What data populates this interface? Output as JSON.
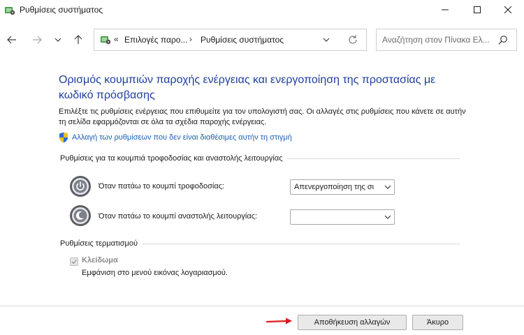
{
  "window": {
    "title": "Ρυθμίσεις συστήματος",
    "app_icon": "control-panel-icon",
    "controls": [
      "minimize",
      "maximize",
      "close"
    ]
  },
  "navigation": {
    "back_icon": "arrow-left-icon",
    "forward_icon": "arrow-right-icon",
    "recent_icon": "chevron-down-icon",
    "up_icon": "arrow-up-icon",
    "address": {
      "prefix": "«",
      "crumbs": [
        "Επιλογές παρο...",
        "Ρυθμίσεις συστήματος"
      ],
      "separator": "›"
    },
    "search_placeholder": "Αναζήτηση στον Πίνακα Ελ..."
  },
  "content": {
    "heading": "Ορισμός κουμπιών παροχής ενέργειας και ενεργοποίηση της προστασίας με κωδικό πρόσβασης",
    "description": "Επιλέξτε τις ρυθμίσεις ενέργειας που επιθυμείτε για τον υπολογιστή σας. Οι αλλαγές στις ρυθμίσεις που κάνετε σε αυτήν τη σελίδα εφαρμόζονται σε όλα τα σχέδια παροχής ενέργειας.",
    "admin_link": "Αλλαγή των ρυθμίσεων που δεν είναι διαθέσιμες αυτήν τη στιγμή",
    "section_buttons": {
      "label": "Ρυθμίσεις για τα κουμπιά τροφοδοσίας και αναστολής λειτουργίας",
      "rows": [
        {
          "label": "Όταν πατάω το κουμπί τροφοδοσίας:",
          "value": "Απενεργοποίηση της σι",
          "icon": "power-button-icon"
        },
        {
          "label": "Όταν πατάω το κουμπί αναστολής λειτουργίας:",
          "value": "",
          "icon": "sleep-button-icon"
        }
      ]
    },
    "section_shutdown": {
      "label": "Ρυθμίσεις τερματισμού",
      "checkbox_label": "Κλείδωμα",
      "checkbox_checked": true,
      "checkbox_enabled": false,
      "checkbox_description": "Εμφάνιση στο μενού εικόνας λογαριασμού."
    }
  },
  "footer": {
    "save_label": "Αποθήκευση αλλαγών",
    "cancel_label": "Άκυρο",
    "annotation_color": "#e0191e"
  },
  "colors": {
    "heading": "#1e3f9e",
    "link": "#1a5fb4"
  }
}
